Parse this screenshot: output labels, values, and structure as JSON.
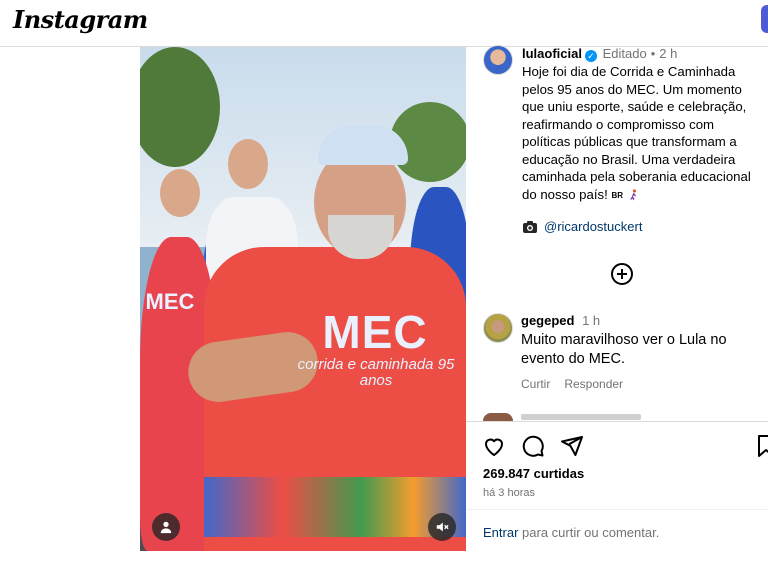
{
  "header": {
    "logo": "Instagram"
  },
  "post": {
    "username": "lulaoficial",
    "edited_label": "Editado",
    "age": "2 h",
    "caption": "Hoje foi dia de Corrida e Caminhada pelos 95 anos do MEC. Um momento que uniu esporte, saúde e celebração, reafirmando o compromisso com políticas públicas que transformam a educação no Brasil. Uma verdadeira caminhada pela soberania educacional do nosso país!",
    "flag_text": "BR",
    "credit": "@ricardostuckert",
    "likes": "269.847 curtidas",
    "timestamp": "há 3 horas"
  },
  "video": {
    "shirt_logo": "MEC",
    "shirt_sub": "corrida e caminhada",
    "shirt_num": "95 anos",
    "left_logo": "MEC"
  },
  "comment": {
    "username": "gegeped",
    "age": "1 h",
    "text": "Muito maravilhoso ver o Lula no evento do MEC.",
    "like_label": "Curtir",
    "reply_label": "Responder"
  },
  "composer": {
    "login_link": "Entrar",
    "prompt": "para curtir ou comentar."
  },
  "colors": {
    "link": "#00376b",
    "verified": "#0095f6",
    "muted": "#737373"
  }
}
